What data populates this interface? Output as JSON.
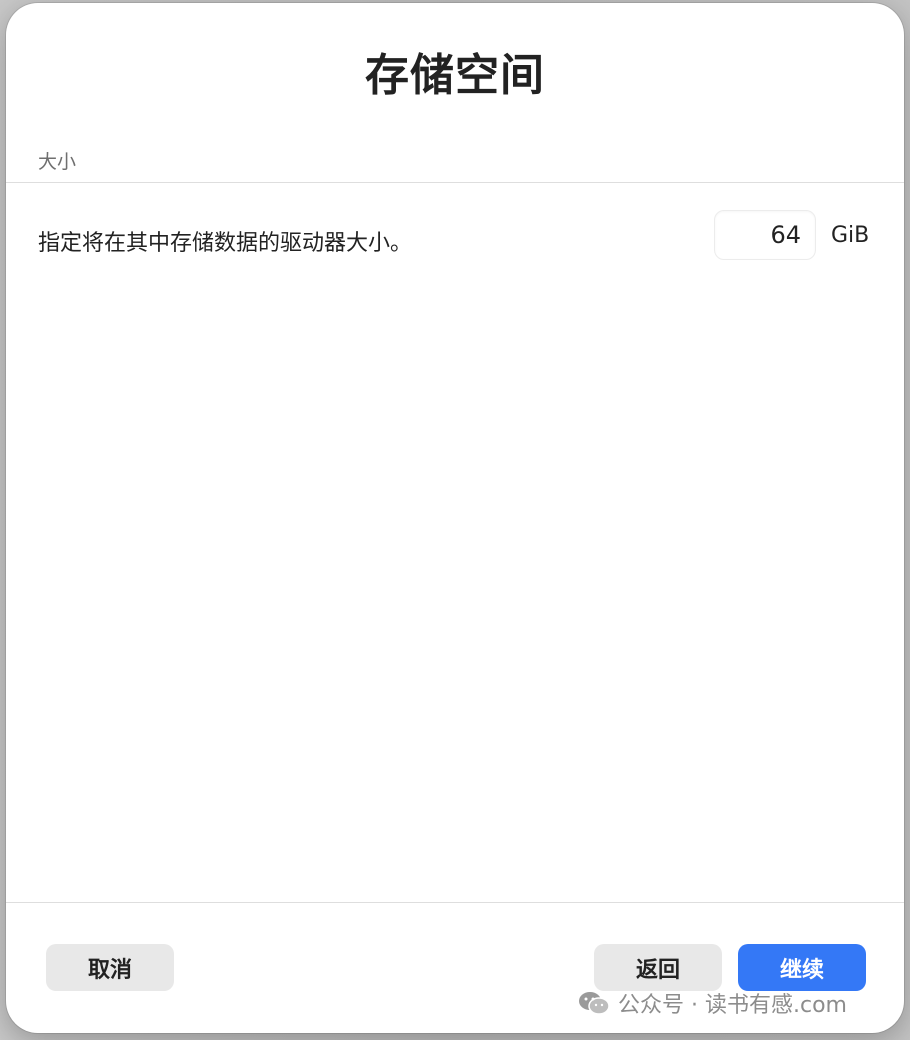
{
  "dialog": {
    "title": "存储空间",
    "section_label": "大小",
    "description": "指定将在其中存储数据的驱动器大小。",
    "size_value": "64",
    "unit": "GiB"
  },
  "buttons": {
    "cancel": "取消",
    "back": "返回",
    "continue": "继续"
  },
  "watermark": {
    "text": "公众号 · 读书有感.com",
    "icon": "wechat-icon"
  },
  "colors": {
    "primary": "#3478f6",
    "secondary_button": "#e8e8e8",
    "text": "#222222",
    "muted_text": "#6f6f6f"
  }
}
